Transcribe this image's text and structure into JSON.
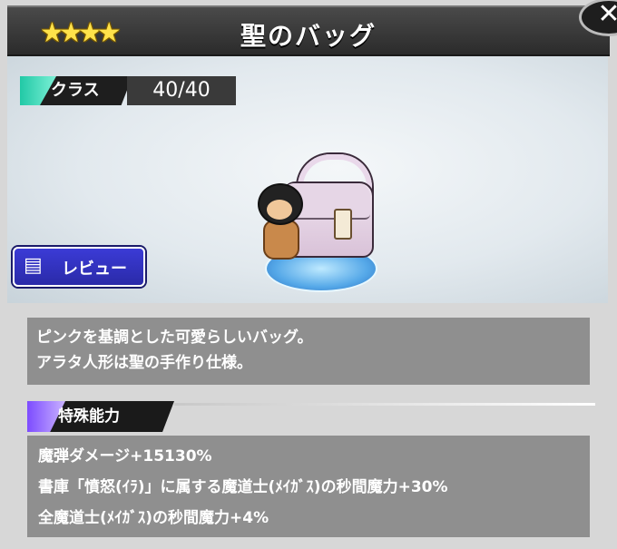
{
  "header": {
    "stars": [
      "★",
      "★",
      "★",
      "★"
    ],
    "title": "聖のバッグ",
    "close_glyph": "✕"
  },
  "class": {
    "label": "クラス",
    "value": "40/40"
  },
  "review": {
    "label": "レビュー",
    "icon": "chat-icon"
  },
  "description": {
    "lines": [
      "ピンクを基調とした可愛らしいバッグ。",
      "アラタ人形は聖の手作り仕様。"
    ]
  },
  "abilities": {
    "header": "特殊能力",
    "items": [
      "魔弾ダメージ+15130%",
      "書庫「憤怒(ｲﾗ)」に属する魔道士(ﾒｲｶﾞｽ)の秒間魔力+30%",
      "全魔道士(ﾒｲｶﾞｽ)の秒間魔力+4%"
    ]
  },
  "colors": {
    "class_accent": "#21c9a6",
    "ability_accent": "#7d4cff",
    "review_button": "#2a2aa8",
    "star_color": "#ffe24a"
  }
}
